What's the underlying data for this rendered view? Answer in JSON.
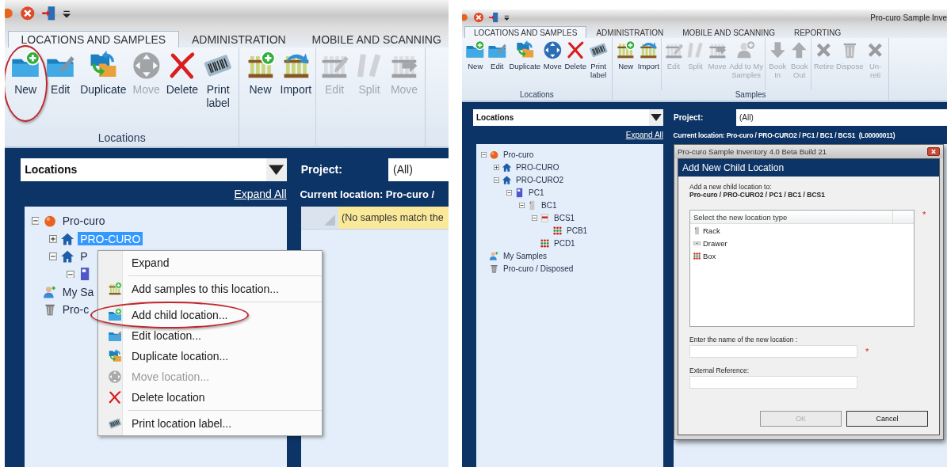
{
  "panels": [
    {
      "tabs": [
        {
          "label": "LOCATIONS AND SAMPLES",
          "selected": true
        },
        {
          "label": "ADMINISTRATION",
          "selected": false
        },
        {
          "label": "MOBILE AND SCANNING",
          "selected": false
        }
      ],
      "ribbon": [
        {
          "label": "Locations",
          "sections": [
            [
              {
                "label": "New",
                "kind": "new-folder",
                "disabled": false,
                "circled": true
              },
              {
                "label": "Edit",
                "kind": "edit-folder",
                "disabled": false,
                "circled": false
              },
              {
                "label": "Duplicate",
                "kind": "duplicate",
                "disabled": false,
                "circled": false
              },
              {
                "label": "Move",
                "kind": "move",
                "disabled": true,
                "circled": false
              },
              {
                "label": "Delete",
                "kind": "delete",
                "disabled": false,
                "circled": false
              },
              {
                "label": "Print\nlabel",
                "kind": "print-label",
                "disabled": false,
                "circled": false
              }
            ]
          ]
        },
        {
          "sections": [
            [
              {
                "label": "New",
                "kind": "new-sample",
                "disabled": false,
                "circled": false
              },
              {
                "label": "Import",
                "kind": "import",
                "disabled": false,
                "circled": false
              }
            ],
            [
              {
                "label": "Edit",
                "kind": "edit-sample",
                "disabled": true,
                "circled": false
              },
              {
                "label": "Split",
                "kind": "split",
                "disabled": true,
                "circled": false
              },
              {
                "label": "Move",
                "kind": "move-sample",
                "disabled": true,
                "circled": false
              }
            ]
          ]
        }
      ],
      "location_selector": "Locations",
      "project_label": "Project:",
      "project_value": "(All)",
      "expand_all": "Expand All",
      "current_location": "Current location: Pro-curo /",
      "tree": [
        {
          "label": "Pro-curo",
          "kind": "site",
          "expanded": true,
          "selected": false,
          "children": [
            {
              "label": "PRO-CURO",
              "kind": "building",
              "expanded": false,
              "selected": true
            },
            {
              "label": "P",
              "kind": "building",
              "expanded": true,
              "selected": false,
              "children": [
                {
                  "kind": "freezer",
                  "expanded": true
                }
              ]
            }
          ]
        },
        {
          "label": "My Sa",
          "kind": "person",
          "selected": false
        },
        {
          "label": "Pro-c",
          "kind": "bin",
          "selected": false
        }
      ],
      "grid": {
        "message": "(No samples match the"
      },
      "context_menu": [
        [
          {
            "label": "Expand",
            "kind": "none",
            "disabled": false,
            "circled": false
          }
        ],
        [
          {
            "label": "Add samples to this location...",
            "kind": "new-sample",
            "disabled": false,
            "circled": false
          }
        ],
        [
          {
            "label": "Add child location...",
            "kind": "new-folder",
            "disabled": false,
            "circled": true
          },
          {
            "label": "Edit location...",
            "kind": "edit-folder",
            "disabled": false,
            "circled": false
          },
          {
            "label": "Duplicate location...",
            "kind": "duplicate",
            "disabled": false,
            "circled": false
          },
          {
            "label": "Move location...",
            "kind": "move",
            "disabled": true,
            "circled": false
          },
          {
            "label": "Delete location",
            "kind": "delete",
            "disabled": false,
            "circled": false
          }
        ],
        [
          {
            "label": "Print location label...",
            "kind": "print-label",
            "disabled": false,
            "circled": false
          }
        ]
      ]
    },
    {
      "title": "Pro-curo Sample Inve",
      "tabs": [
        {
          "label": "LOCATIONS AND SAMPLES",
          "selected": true
        },
        {
          "label": "ADMINISTRATION",
          "selected": false
        },
        {
          "label": "MOBILE AND SCANNING",
          "selected": false
        },
        {
          "label": "REPORTING",
          "selected": false
        }
      ],
      "ribbon": [
        {
          "label": "Locations",
          "sections": [
            [
              {
                "label": "New",
                "kind": "new-folder",
                "disabled": false
              },
              {
                "label": "Edit",
                "kind": "edit-folder",
                "disabled": false
              },
              {
                "label": "Duplicate",
                "kind": "duplicate",
                "disabled": false
              },
              {
                "label": "Move",
                "kind": "move",
                "disabled": false
              },
              {
                "label": "Delete",
                "kind": "delete",
                "disabled": false
              },
              {
                "label": "Print\nlabel",
                "kind": "print-label",
                "disabled": false
              }
            ]
          ]
        },
        {
          "label": "Samples",
          "sections": [
            [
              {
                "label": "New",
                "kind": "new-sample",
                "disabled": false
              },
              {
                "label": "Import",
                "kind": "import",
                "disabled": false
              }
            ],
            [
              {
                "label": "Edit",
                "kind": "edit-sample",
                "disabled": true
              },
              {
                "label": "Split",
                "kind": "split",
                "disabled": true
              },
              {
                "label": "Move",
                "kind": "move-sample",
                "disabled": true
              },
              {
                "label": "Add to My\nSamples",
                "kind": "add-person",
                "disabled": true
              }
            ],
            [
              {
                "label": "Book\nIn",
                "kind": "book-in",
                "disabled": true
              },
              {
                "label": "Book\nOut",
                "kind": "book-out",
                "disabled": true
              }
            ],
            [
              {
                "label": "Retire",
                "kind": "retire",
                "disabled": true
              },
              {
                "label": "Dispose",
                "kind": "dispose",
                "disabled": true
              },
              {
                "label": "Un-\nreti",
                "kind": "retire",
                "disabled": true
              }
            ]
          ]
        }
      ],
      "location_selector": "Locations",
      "project_label": "Project:",
      "project_value": "(All)",
      "expand_all": "Expand All",
      "current_location": "Current location: Pro-curo / PRO-CURO2 / PC1 / BC1 / BCS1  (L00000011)",
      "tree": [
        {
          "label": "Pro-curo",
          "kind": "site",
          "expanded": true,
          "selected": false,
          "children": [
            {
              "label": "PRO-CURO",
              "kind": "building",
              "expanded": false,
              "selected": false
            },
            {
              "label": "PRO-CURO2",
              "kind": "building",
              "expanded": true,
              "selected": false,
              "children": [
                {
                  "label": "PC1",
                  "kind": "freezer",
                  "expanded": true,
                  "selected": false,
                  "children": [
                    {
                      "label": "BC1",
                      "kind": "rack",
                      "expanded": true,
                      "selected": false,
                      "children": [
                        {
                          "label": "BCS1",
                          "kind": "shelf",
                          "expanded": true,
                          "selected": false,
                          "children": [
                            {
                              "label": "PCB1",
                              "kind": "box",
                              "selected": false
                            }
                          ]
                        },
                        {
                          "label": "PCD1",
                          "kind": "box",
                          "selected": false
                        }
                      ]
                    }
                  ]
                }
              ]
            }
          ]
        },
        {
          "label": "My Samples",
          "kind": "person",
          "selected": false
        },
        {
          "label": "Pro-curo / Disposed",
          "kind": "bin",
          "selected": false
        }
      ],
      "dialog": {
        "title": "Pro-curo Sample Inventory 4.0 Beta Build 21",
        "header": "Add New Child Location",
        "intro": "Add a new child location to:",
        "path": "Pro-curo / PRO-CURO2 / PC1 / BC1 / BCS1",
        "list": {
          "header": "Select the new location type",
          "required_mark": "*",
          "items": [
            {
              "label": "Rack",
              "kind": "rack",
              "selected": false
            },
            {
              "label": "Drawer",
              "kind": "drawer",
              "selected": false
            },
            {
              "label": "Box",
              "kind": "box",
              "selected": false
            }
          ]
        },
        "fields": [
          {
            "label": "Enter the name of the new location :",
            "required_mark": "*"
          },
          {
            "label": "External Reference:"
          }
        ],
        "buttons": [
          {
            "label": "OK",
            "disabled": true
          },
          {
            "label": "Cancel",
            "disabled": false
          }
        ]
      }
    }
  ]
}
